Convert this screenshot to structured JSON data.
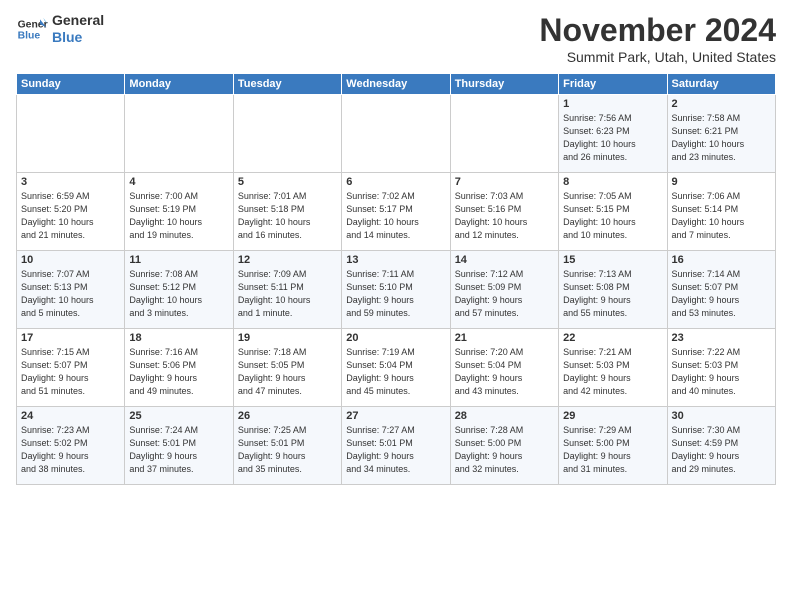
{
  "logo": {
    "line1": "General",
    "line2": "Blue"
  },
  "title": "November 2024",
  "location": "Summit Park, Utah, United States",
  "days_header": [
    "Sunday",
    "Monday",
    "Tuesday",
    "Wednesday",
    "Thursday",
    "Friday",
    "Saturday"
  ],
  "weeks": [
    [
      {
        "day": "",
        "content": ""
      },
      {
        "day": "",
        "content": ""
      },
      {
        "day": "",
        "content": ""
      },
      {
        "day": "",
        "content": ""
      },
      {
        "day": "",
        "content": ""
      },
      {
        "day": "1",
        "content": "Sunrise: 7:56 AM\nSunset: 6:23 PM\nDaylight: 10 hours\nand 26 minutes."
      },
      {
        "day": "2",
        "content": "Sunrise: 7:58 AM\nSunset: 6:21 PM\nDaylight: 10 hours\nand 23 minutes."
      }
    ],
    [
      {
        "day": "3",
        "content": "Sunrise: 6:59 AM\nSunset: 5:20 PM\nDaylight: 10 hours\nand 21 minutes."
      },
      {
        "day": "4",
        "content": "Sunrise: 7:00 AM\nSunset: 5:19 PM\nDaylight: 10 hours\nand 19 minutes."
      },
      {
        "day": "5",
        "content": "Sunrise: 7:01 AM\nSunset: 5:18 PM\nDaylight: 10 hours\nand 16 minutes."
      },
      {
        "day": "6",
        "content": "Sunrise: 7:02 AM\nSunset: 5:17 PM\nDaylight: 10 hours\nand 14 minutes."
      },
      {
        "day": "7",
        "content": "Sunrise: 7:03 AM\nSunset: 5:16 PM\nDaylight: 10 hours\nand 12 minutes."
      },
      {
        "day": "8",
        "content": "Sunrise: 7:05 AM\nSunset: 5:15 PM\nDaylight: 10 hours\nand 10 minutes."
      },
      {
        "day": "9",
        "content": "Sunrise: 7:06 AM\nSunset: 5:14 PM\nDaylight: 10 hours\nand 7 minutes."
      }
    ],
    [
      {
        "day": "10",
        "content": "Sunrise: 7:07 AM\nSunset: 5:13 PM\nDaylight: 10 hours\nand 5 minutes."
      },
      {
        "day": "11",
        "content": "Sunrise: 7:08 AM\nSunset: 5:12 PM\nDaylight: 10 hours\nand 3 minutes."
      },
      {
        "day": "12",
        "content": "Sunrise: 7:09 AM\nSunset: 5:11 PM\nDaylight: 10 hours\nand 1 minute."
      },
      {
        "day": "13",
        "content": "Sunrise: 7:11 AM\nSunset: 5:10 PM\nDaylight: 9 hours\nand 59 minutes."
      },
      {
        "day": "14",
        "content": "Sunrise: 7:12 AM\nSunset: 5:09 PM\nDaylight: 9 hours\nand 57 minutes."
      },
      {
        "day": "15",
        "content": "Sunrise: 7:13 AM\nSunset: 5:08 PM\nDaylight: 9 hours\nand 55 minutes."
      },
      {
        "day": "16",
        "content": "Sunrise: 7:14 AM\nSunset: 5:07 PM\nDaylight: 9 hours\nand 53 minutes."
      }
    ],
    [
      {
        "day": "17",
        "content": "Sunrise: 7:15 AM\nSunset: 5:07 PM\nDaylight: 9 hours\nand 51 minutes."
      },
      {
        "day": "18",
        "content": "Sunrise: 7:16 AM\nSunset: 5:06 PM\nDaylight: 9 hours\nand 49 minutes."
      },
      {
        "day": "19",
        "content": "Sunrise: 7:18 AM\nSunset: 5:05 PM\nDaylight: 9 hours\nand 47 minutes."
      },
      {
        "day": "20",
        "content": "Sunrise: 7:19 AM\nSunset: 5:04 PM\nDaylight: 9 hours\nand 45 minutes."
      },
      {
        "day": "21",
        "content": "Sunrise: 7:20 AM\nSunset: 5:04 PM\nDaylight: 9 hours\nand 43 minutes."
      },
      {
        "day": "22",
        "content": "Sunrise: 7:21 AM\nSunset: 5:03 PM\nDaylight: 9 hours\nand 42 minutes."
      },
      {
        "day": "23",
        "content": "Sunrise: 7:22 AM\nSunset: 5:03 PM\nDaylight: 9 hours\nand 40 minutes."
      }
    ],
    [
      {
        "day": "24",
        "content": "Sunrise: 7:23 AM\nSunset: 5:02 PM\nDaylight: 9 hours\nand 38 minutes."
      },
      {
        "day": "25",
        "content": "Sunrise: 7:24 AM\nSunset: 5:01 PM\nDaylight: 9 hours\nand 37 minutes."
      },
      {
        "day": "26",
        "content": "Sunrise: 7:25 AM\nSunset: 5:01 PM\nDaylight: 9 hours\nand 35 minutes."
      },
      {
        "day": "27",
        "content": "Sunrise: 7:27 AM\nSunset: 5:01 PM\nDaylight: 9 hours\nand 34 minutes."
      },
      {
        "day": "28",
        "content": "Sunrise: 7:28 AM\nSunset: 5:00 PM\nDaylight: 9 hours\nand 32 minutes."
      },
      {
        "day": "29",
        "content": "Sunrise: 7:29 AM\nSunset: 5:00 PM\nDaylight: 9 hours\nand 31 minutes."
      },
      {
        "day": "30",
        "content": "Sunrise: 7:30 AM\nSunset: 4:59 PM\nDaylight: 9 hours\nand 29 minutes."
      }
    ]
  ]
}
